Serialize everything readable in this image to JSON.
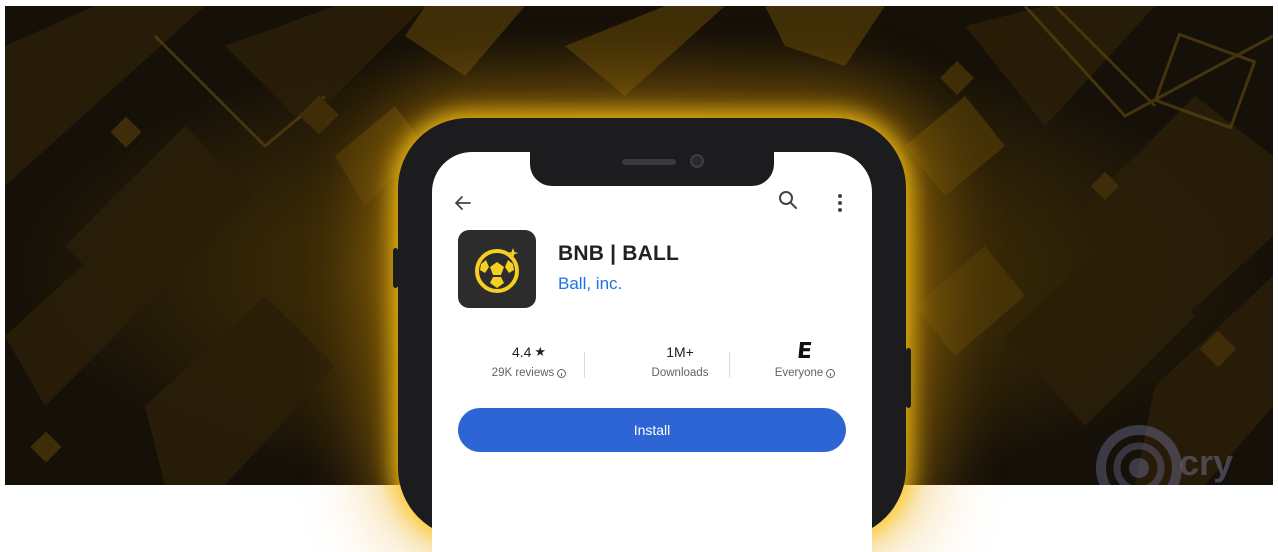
{
  "app": {
    "title": "BNB | BALL",
    "developer": "Ball, inc.",
    "install_label": "Install"
  },
  "stats": {
    "rating_value": "4.4",
    "rating_star": "★",
    "reviews_label": "29K reviews",
    "downloads_value": "1M+",
    "downloads_label": "Downloads",
    "content_rating_glyph": "E",
    "content_rating_label": "Everyone"
  },
  "icons": {
    "back": "arrow-left-icon",
    "search": "search-icon",
    "more": "more-vertical-icon",
    "info": "info-icon",
    "app": "soccer-ball-icon"
  },
  "colors": {
    "accent_blue": "#2d65d4",
    "link_blue": "#1a73e8",
    "glow_yellow": "#ffc814",
    "icon_yellow": "#f5d020"
  },
  "watermark": {
    "text": "cry"
  }
}
